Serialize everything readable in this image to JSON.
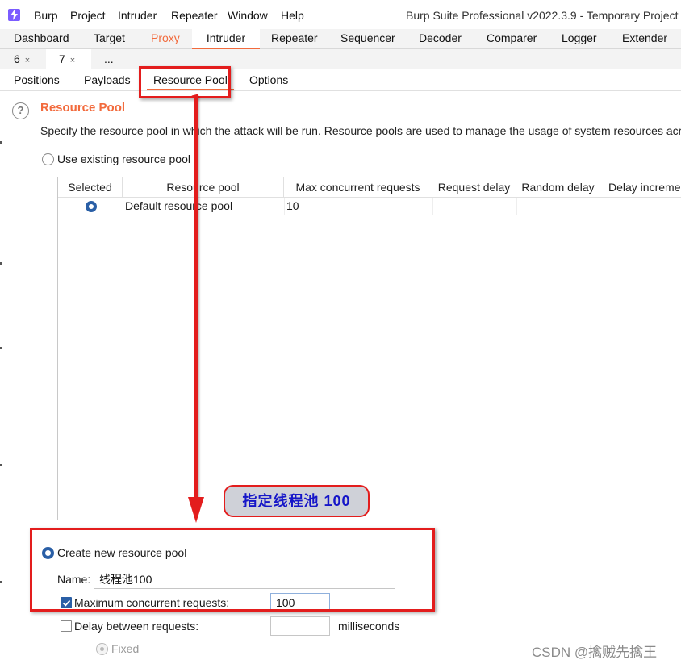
{
  "titlebar": {
    "menu": [
      "Burp",
      "Project",
      "Intruder",
      "Repeater",
      "Window",
      "Help"
    ],
    "window_title": "Burp Suite Professional v2022.3.9 - Temporary Project -"
  },
  "main_tabs": [
    "Dashboard",
    "Target",
    "Proxy",
    "Intruder",
    "Repeater",
    "Sequencer",
    "Decoder",
    "Comparer",
    "Logger",
    "Extender"
  ],
  "active_main_tab": "Intruder",
  "attack_tabs": [
    {
      "label": "6",
      "close": "×"
    },
    {
      "label": "7",
      "close": "×"
    },
    {
      "label": "..."
    }
  ],
  "sub_tabs": [
    "Positions",
    "Payloads",
    "Resource Pool",
    "Options"
  ],
  "active_sub_tab": "Resource Pool",
  "section": {
    "help_glyph": "?",
    "title": "Resource Pool",
    "description": "Specify the resource pool in which the attack will be run. Resource pools are used to manage the usage of system resources acro"
  },
  "use_existing": {
    "label": "Use existing resource pool",
    "selected": false
  },
  "pools_table": {
    "columns": [
      "Selected",
      "Resource pool",
      "Max concurrent requests",
      "Request delay",
      "Random delay",
      "Delay incremen"
    ],
    "rows": [
      {
        "selected": true,
        "name": "Default resource pool",
        "max_concurrent": "10",
        "request_delay": "",
        "random_delay": "",
        "delay_increment": ""
      }
    ]
  },
  "create_new": {
    "label": "Create new resource pool",
    "selected": true,
    "name_label": "Name:",
    "name_value": "线程池100",
    "max_concurrent_label": "Maximum concurrent requests:",
    "max_concurrent_checked": true,
    "max_concurrent_value": "100",
    "delay_label": "Delay between requests:",
    "delay_checked": false,
    "delay_value": "",
    "delay_unit": "milliseconds",
    "fixed_label": "Fixed"
  },
  "annotation": {
    "callout_text": "指定线程池 100",
    "color": "#e31d1d"
  },
  "watermark": "CSDN @擒贼先擒王",
  "colors": {
    "accent": "#f26a3c",
    "radio_selected": "#2a5fa6",
    "annotation_text": "#1616c8"
  }
}
